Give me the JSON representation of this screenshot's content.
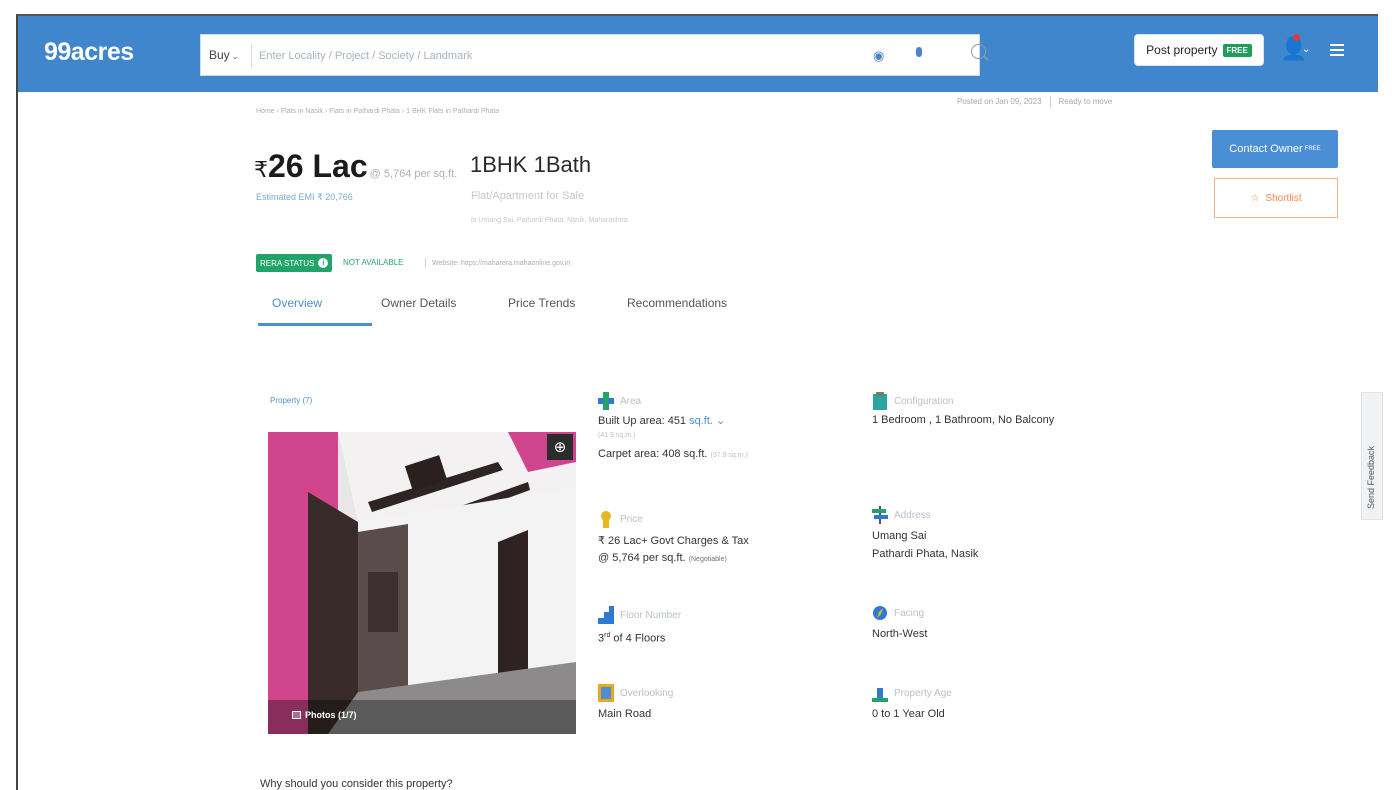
{
  "header": {
    "logo": "99acres",
    "buy_label": "Buy",
    "search_placeholder": "Enter Locality / Project / Society / Landmark",
    "post_property_label": "Post property",
    "free_tag": "FREE"
  },
  "listing": {
    "breadcrumb": "Home › Flats in Nasik › Flats in Pathardi Phata › 1 BHK Flats in Pathardi Phata",
    "posted_on": "Posted on Jan 09, 2023",
    "ready_status": "Ready to move",
    "rupee": "₹",
    "price": "26 Lac",
    "price_per_sqft": "@ 5,764 per sq.ft.",
    "emi": "Estimated EMI ₹ 20,766",
    "bhk": "1BHK 1Bath",
    "type": "Flat/Apartment for Sale",
    "locality": "in Umang Sai, Pathardi Phata, Nasik, Maharashtra",
    "rera_label": "RERA STATUS",
    "rera_status": "NOT AVAILABLE",
    "website": "Website: https://maharera.mahaonline.gov.in"
  },
  "actions": {
    "contact_owner": "Contact Owner",
    "contact_free": "FREE",
    "shortlist": "Shortlist"
  },
  "tabs": [
    {
      "label": "Overview",
      "active": true
    },
    {
      "label": "Owner Details"
    },
    {
      "label": "Price Trends"
    },
    {
      "label": "Recommendations"
    }
  ],
  "property": {
    "label": "Property (7)",
    "photos_badge": "Photos (1/7)"
  },
  "details": {
    "area": {
      "label": "Area",
      "built_up": "Built Up area: 451",
      "unit": "sq.ft.",
      "built_up_sqm": "(41.9 sq.m.)",
      "carpet": "Carpet area: 408 sq.ft.",
      "carpet_sqm": "(37.9 sq.m.)"
    },
    "configuration": {
      "label": "Configuration",
      "value": "1 Bedroom , 1 Bathroom, No Balcony"
    },
    "price": {
      "label": "Price",
      "value": "₹ 26 Lac+ Govt Charges & Tax",
      "per": "@ 5,764 per sq.ft.",
      "negotiable": "(Negotiable)"
    },
    "address": {
      "label": "Address",
      "line1": "Umang Sai",
      "line2": "Pathardi Phata, Nasik"
    },
    "floor": {
      "label": "Floor Number",
      "value_num": "3",
      "value_sup": "rd",
      "value_rest": "of 4 Floors"
    },
    "facing": {
      "label": "Facing",
      "value": "North-West"
    },
    "overlooking": {
      "label": "Overlooking",
      "value": "Main Road"
    },
    "age": {
      "label": "Property Age",
      "value": "0 to 1 Year Old"
    }
  },
  "feedback": "Send Feedback",
  "why_heading": "Why should you consider this property?",
  "colors": {
    "header_blue": "#3f86cc",
    "accent_blue": "#4a8fd6",
    "rera_green": "#22a36a",
    "shortlist_orange": "#f08a4b"
  }
}
